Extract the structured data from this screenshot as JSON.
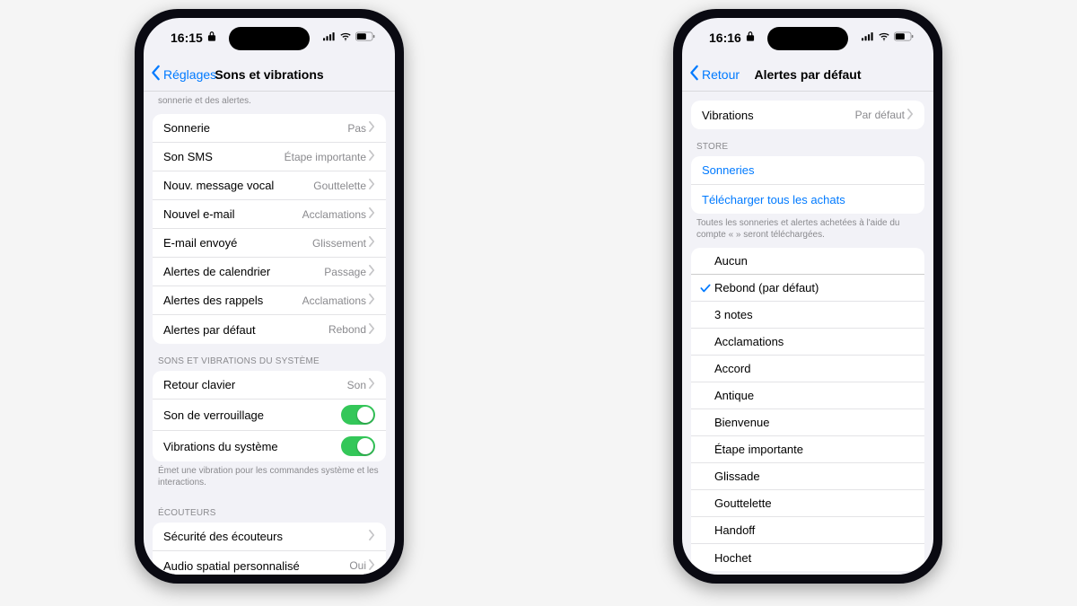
{
  "left": {
    "time": "16:15",
    "back": "Réglages",
    "title": "Sons et vibrations",
    "top_footer": "sonnerie et des alertes.",
    "rows": [
      {
        "label": "Sonnerie",
        "value": "Pas"
      },
      {
        "label": "Son SMS",
        "value": "Étape importante"
      },
      {
        "label": "Nouv. message vocal",
        "value": "Gouttelette"
      },
      {
        "label": "Nouvel e-mail",
        "value": "Acclamations"
      },
      {
        "label": "E-mail envoyé",
        "value": "Glissement"
      },
      {
        "label": "Alertes de calendrier",
        "value": "Passage"
      },
      {
        "label": "Alertes des rappels",
        "value": "Acclamations"
      },
      {
        "label": "Alertes par défaut",
        "value": "Rebond"
      }
    ],
    "sys_header": "Sons et vibrations du système",
    "sys_rows": {
      "keyboard": {
        "label": "Retour clavier",
        "value": "Son"
      },
      "lock": {
        "label": "Son de verrouillage"
      },
      "vib": {
        "label": "Vibrations du système"
      }
    },
    "sys_footer": "Émet une vibration pour les commandes système et les interactions.",
    "ear_header": "Écouteurs",
    "ear_rows": {
      "safety": {
        "label": "Sécurité des écouteurs"
      },
      "spatial": {
        "label": "Audio spatial personnalisé",
        "value": "Oui"
      }
    }
  },
  "right": {
    "time": "16:16",
    "back": "Retour",
    "title": "Alertes par défaut",
    "vib_row": {
      "label": "Vibrations",
      "value": "Par défaut"
    },
    "store_header": "Store",
    "store_rows": {
      "ringtones": "Sonneries",
      "download": "Télécharger tous les achats"
    },
    "store_footer": "Toutes les sonneries et alertes achetées à l'aide du compte «                                           » seront téléchargées.",
    "sounds": [
      "Aucun",
      "Rebond (par défaut)",
      "3 notes",
      "Acclamations",
      "Accord",
      "Antique",
      "Bienvenue",
      "Étape importante",
      "Glissade",
      "Gouttelette",
      "Handoff",
      "Hochet"
    ],
    "selected_index": 1
  }
}
